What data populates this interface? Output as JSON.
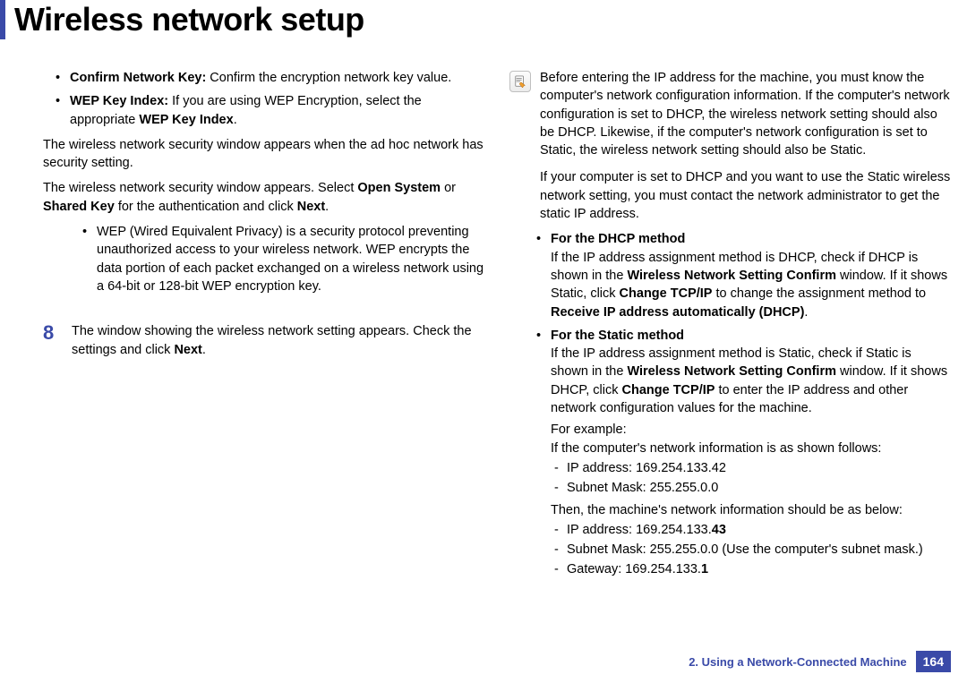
{
  "title": "Wireless network setup",
  "col1": {
    "bul1_bold": "Confirm Network Key:",
    "bul1_rest": " Confirm the encryption network key value.",
    "bul2_bold1": "WEP Key Index:",
    "bul2_mid": " If you are using WEP Encryption, select the appropriate ",
    "bul2_bold2": "WEP Key Index",
    "p1": "The wireless network security window appears when the ad hoc network has security setting.",
    "p2_a": "The wireless network security window appears. Select ",
    "p2_b1": "Open System",
    "p2_mid": " or ",
    "p2_b2": "Shared Key",
    "p2_c": " for the authentication and click ",
    "p2_b3": "Next",
    "sub1": "WEP (Wired Equivalent Privacy) is a security protocol preventing unauthorized access to your wireless network. WEP encrypts the data portion of each packet exchanged on a wireless network using a 64-bit or 128-bit WEP encryption key.",
    "step_num": "8",
    "step_a": "The window showing the wireless network setting appears. Check the settings and click ",
    "step_b": "Next"
  },
  "col2": {
    "note1": "Before entering the IP address for the machine, you must know the computer's network configuration information. If the computer's network configuration is set to DHCP, the wireless network setting should also be DHCP. Likewise, if the computer's network configuration is set to Static, the wireless network setting should also be Static.",
    "note2": "If your computer is set to DHCP and you want to use the Static wireless network setting, you must contact the network administrator to get the static IP address.",
    "dhcp_head": "For the DHCP method",
    "dhcp_a": "If the IP address assignment method is DHCP, check if DHCP is shown in the ",
    "dhcp_b1": "Wireless Network Setting Confirm",
    "dhcp_mid": " window. If it shows Static, click ",
    "dhcp_b2": "Change TCP/IP",
    "dhcp_mid2": " to change the assignment method to ",
    "dhcp_b3": "Receive IP address automatically (DHCP)",
    "static_head": "For the Static method",
    "static_a": "If the IP address assignment method is Static, check if Static is shown in the ",
    "static_b1": "Wireless Network Setting Confirm",
    "static_mid": " window. If it shows DHCP, click ",
    "static_b2": "Change TCP/IP",
    "static_c": " to enter the IP address and other network configuration values for the machine.",
    "example_label": "For example:",
    "example_intro": "If the computer's network information is as shown follows:",
    "ex_ip": "IP address: 169.254.133.42",
    "ex_mask": "Subnet Mask: 255.255.0.0",
    "then_label": "Then, the machine's network information should be as below:",
    "m_ip_a": "IP address: 169.254.133.",
    "m_ip_b": "43",
    "m_mask": "Subnet Mask: 255.255.0.0 (Use the computer's subnet mask.)",
    "m_gw_a": "Gateway: 169.254.133.",
    "m_gw_b": "1"
  },
  "footer": {
    "chapter": "2.  Using a Network-Connected Machine",
    "page": "164"
  }
}
